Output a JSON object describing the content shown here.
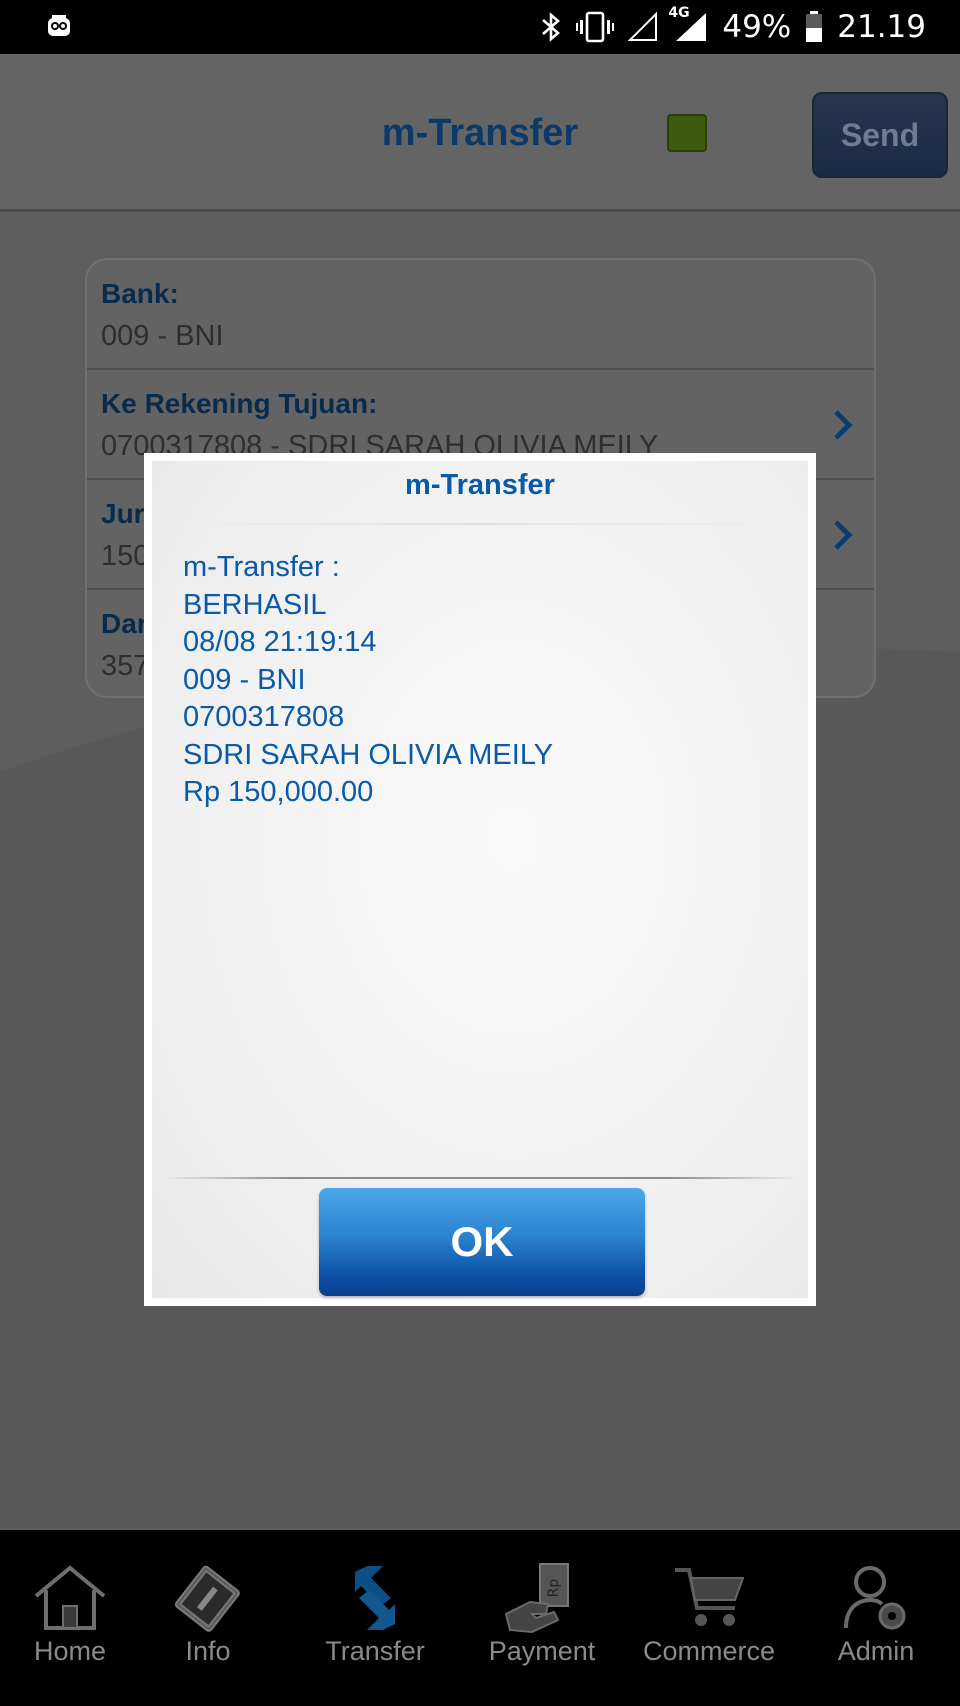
{
  "status_bar": {
    "battery": "49%",
    "time": "21.19",
    "network": "4G"
  },
  "header": {
    "title": "m-Transfer",
    "send_label": "Send",
    "indicator_color": "#3d5a10"
  },
  "form": {
    "rows": [
      {
        "label": "Bank:",
        "value": "009 - BNI"
      },
      {
        "label": "Ke Rekening Tujuan:",
        "value": "0700317808 - SDRI SARAH OLIVIA MEILY"
      },
      {
        "label": "Jur",
        "value": "150"
      },
      {
        "label": "Dar",
        "value": "357"
      }
    ]
  },
  "dialog": {
    "title": "m-Transfer",
    "lines": [
      "m-Transfer :",
      "BERHASIL",
      "08/08 21:19:14",
      "009 - BNI",
      "0700317808",
      "SDRI SARAH OLIVIA MEILY",
      "Rp 150,000.00"
    ],
    "ok_label": "OK"
  },
  "bottom_nav": {
    "items": [
      {
        "label": "Home",
        "icon": "home-icon"
      },
      {
        "label": "Info",
        "icon": "info-icon"
      },
      {
        "label": "Transfer",
        "icon": "transfer-icon"
      },
      {
        "label": "Payment",
        "icon": "payment-icon"
      },
      {
        "label": "Commerce",
        "icon": "cart-icon"
      },
      {
        "label": "Admin",
        "icon": "admin-icon"
      }
    ]
  },
  "colors": {
    "accent": "#0a5aa8",
    "dim_overlay": "#595959"
  }
}
